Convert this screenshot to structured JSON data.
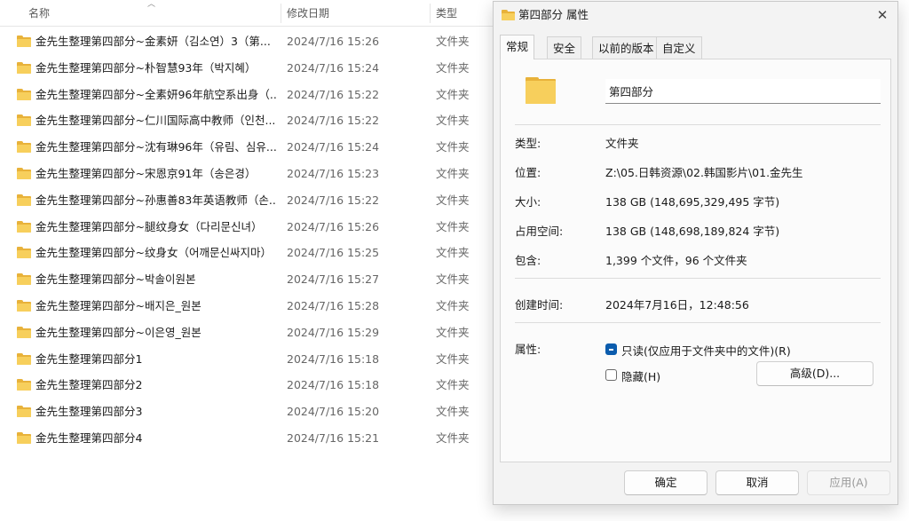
{
  "explorer": {
    "columns": {
      "name": "名称",
      "date": "修改日期",
      "type": "类型"
    },
    "rows": [
      {
        "name": "金先生整理第四部分~金素妍（김소연）3（第...",
        "date": "2024/7/16 15:26",
        "type": "文件夹"
      },
      {
        "name": "金先生整理第四部分~朴智慧93年（박지혜）",
        "date": "2024/7/16 15:24",
        "type": "文件夹"
      },
      {
        "name": "金先生整理第四部分~全素妍96年航空系出身（...",
        "date": "2024/7/16 15:22",
        "type": "文件夹"
      },
      {
        "name": "金先生整理第四部分~仁川国际高中教师（인천...",
        "date": "2024/7/16 15:22",
        "type": "文件夹"
      },
      {
        "name": "金先生整理第四部分~沈有琳96年（유림、심유...",
        "date": "2024/7/16 15:24",
        "type": "文件夹"
      },
      {
        "name": "金先生整理第四部分~宋恩京91年（송은경）",
        "date": "2024/7/16 15:23",
        "type": "文件夹"
      },
      {
        "name": "金先生整理第四部分~孙惠善83年英语教师（손...",
        "date": "2024/7/16 15:22",
        "type": "文件夹"
      },
      {
        "name": "金先生整理第四部分~腿纹身女（다리문신녀）",
        "date": "2024/7/16 15:26",
        "type": "文件夹"
      },
      {
        "name": "金先生整理第四部分~纹身女（어깨문신싸지마）",
        "date": "2024/7/16 15:25",
        "type": "文件夹"
      },
      {
        "name": "金先生整理第四部分~박솔이원본",
        "date": "2024/7/16 15:27",
        "type": "文件夹"
      },
      {
        "name": "金先生整理第四部分~배지은_원본",
        "date": "2024/7/16 15:28",
        "type": "文件夹"
      },
      {
        "name": "金先生整理第四部分~이은영_원본",
        "date": "2024/7/16 15:29",
        "type": "文件夹"
      },
      {
        "name": "金先生整理第四部分1",
        "date": "2024/7/16 15:18",
        "type": "文件夹"
      },
      {
        "name": "金先生整理第四部分2",
        "date": "2024/7/16 15:18",
        "type": "文件夹"
      },
      {
        "name": "金先生整理第四部分3",
        "date": "2024/7/16 15:20",
        "type": "文件夹"
      },
      {
        "name": "金先生整理第四部分4",
        "date": "2024/7/16 15:21",
        "type": "文件夹"
      }
    ]
  },
  "dialog": {
    "title": "第四部分 属性",
    "close_glyph": "✕",
    "tabs": [
      "常规",
      "安全",
      "以前的版本",
      "自定义"
    ],
    "folder_name": "第四部分",
    "props": [
      {
        "label": "类型:",
        "value": "文件夹"
      },
      {
        "label": "位置:",
        "value": "Z:\\05.日韩资源\\02.韩国影片\\01.金先生"
      },
      {
        "label": "大小:",
        "value": "138 GB (148,695,329,495 字节)"
      },
      {
        "label": "占用空间:",
        "value": "138 GB (148,698,189,824 字节)"
      },
      {
        "label": "包含:",
        "value": "1,399 个文件，96 个文件夹"
      },
      {
        "label": "创建时间:",
        "value": "2024年7月16日，12:48:56"
      }
    ],
    "attributes_label": "属性:",
    "readonly_label": "只读(仅应用于文件夹中的文件)(R)",
    "hidden_label": "隐藏(H)",
    "advanced_button": "高级(D)...",
    "buttons": {
      "ok": "确定",
      "cancel": "取消",
      "apply": "应用(A)"
    }
  },
  "colors": {
    "folder": "#f7cf5c",
    "folder_back": "#e8b23a",
    "accent": "#0b5cad"
  },
  "icons": {
    "folder": "folder-icon",
    "close": "close-icon"
  }
}
